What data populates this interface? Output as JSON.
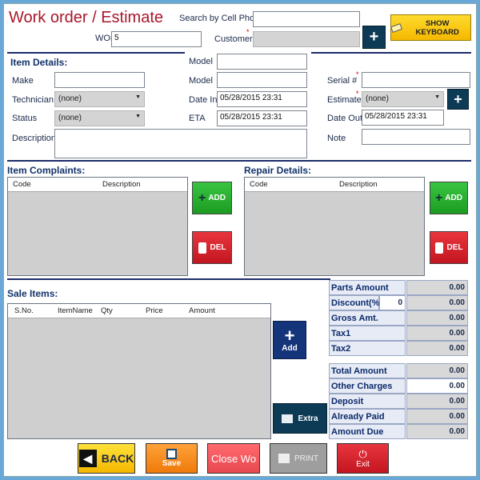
{
  "header": {
    "title": "Work order / Estimate",
    "wo_label": "WO#",
    "wo_value": "5",
    "search_label": "Search by Cell Phone",
    "search_value": "",
    "customer_label": "Customer",
    "customer_value": "",
    "keyboard_button": "SHOW KEYBOARD",
    "required_mark": "*"
  },
  "item_details": {
    "heading": "Item Details:",
    "make_label": "Make",
    "make_value": "",
    "technician_label": "Technician",
    "technician_value": "(none)",
    "status_label": "Status",
    "status_value": "(none)",
    "description_label": "Description",
    "description_value": "",
    "model_label_1": "Model",
    "model_value_1": "",
    "model_label_2": "Model",
    "model_value_2": "",
    "date_in_label": "Date In",
    "date_in_value": "05/28/2015 23:31",
    "eta_label": "ETA",
    "eta_value": "05/28/2015 23:31",
    "serial_label": "Serial #",
    "serial_value": "",
    "estimate_label": "Estimate",
    "estimate_value": "(none)",
    "date_out_label": "Date Out",
    "date_out_value": "05/28/2015 23:31",
    "note_label": "Note",
    "note_value": ""
  },
  "complaints": {
    "heading": "Item Complaints:",
    "columns": [
      "Code",
      "Description"
    ],
    "add_label": "ADD",
    "del_label": "DEL"
  },
  "repair": {
    "heading": "Repair Details:",
    "columns": [
      "Code",
      "Description"
    ],
    "add_label": "ADD",
    "del_label": "DEL"
  },
  "sale_items": {
    "heading": "Sale Items:",
    "columns": [
      "S.No.",
      "ItemName",
      "Qty",
      "Price",
      "Amount"
    ],
    "add_label": "Add",
    "extra_label": "Extra"
  },
  "totals": {
    "parts_amount_label": "Parts Amount",
    "parts_amount": "0.00",
    "discount_label": "Discount(%)",
    "discount_pct": "0",
    "discount": "0.00",
    "gross_label": "Gross Amt.",
    "gross": "0.00",
    "tax1_label": "Tax1",
    "tax1": "0.00",
    "tax2_label": "Tax2",
    "tax2": "0.00",
    "total_label": "Total Amount",
    "total": "0.00",
    "other_label": "Other Charges",
    "other": "0.00",
    "deposit_label": "Deposit",
    "deposit": "0.00",
    "paid_label": "Already Paid",
    "paid": "0.00",
    "due_label": "Amount Due",
    "due": "0.00"
  },
  "footer": {
    "back": "BACK",
    "save": "Save",
    "close": "Close Wo",
    "print": "PRINT",
    "exit": "Exit"
  },
  "colors": {
    "title": "#a8172a",
    "heading": "#12326a",
    "green": "#1c9c22",
    "red": "#c31621",
    "navy": "#15357a",
    "orange": "#f7941d",
    "yellow": "#ffd200"
  }
}
